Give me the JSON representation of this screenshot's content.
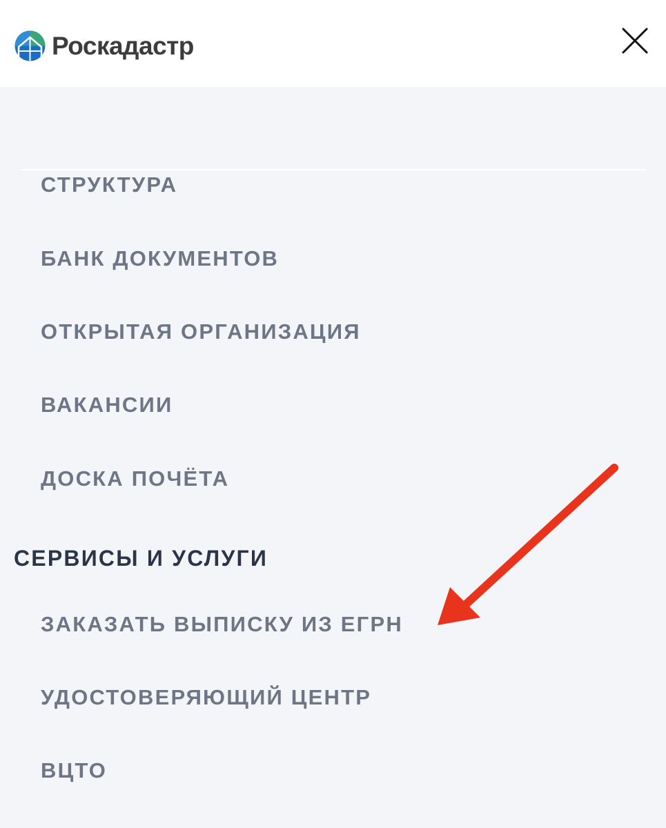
{
  "header": {
    "logo_text": "Роскадастр",
    "close_icon": "close-icon"
  },
  "menu": {
    "about_items": [
      "СТРУКТУРА",
      "БАНК ДОКУМЕНТОВ",
      "ОТКРЫТАЯ ОРГАНИЗАЦИЯ",
      "ВАКАНСИИ",
      "ДОСКА ПОЧЁТА"
    ],
    "services_title": "СЕРВИСЫ И УСЛУГИ",
    "services_items": [
      "ЗАКАЗАТЬ ВЫПИСКУ ИЗ ЕГРН",
      "УДОСТОВЕРЯЮЩИЙ ЦЕНТР",
      "ВЦТО"
    ]
  },
  "colors": {
    "background": "#f4f5f8",
    "header_background": "#ffffff",
    "menu_item_text": "#6e7686",
    "section_title_text": "#2b3547",
    "annotation_arrow": "#e8341c",
    "logo_blue": "#1a6fc2",
    "logo_green": "#3aa57a"
  }
}
